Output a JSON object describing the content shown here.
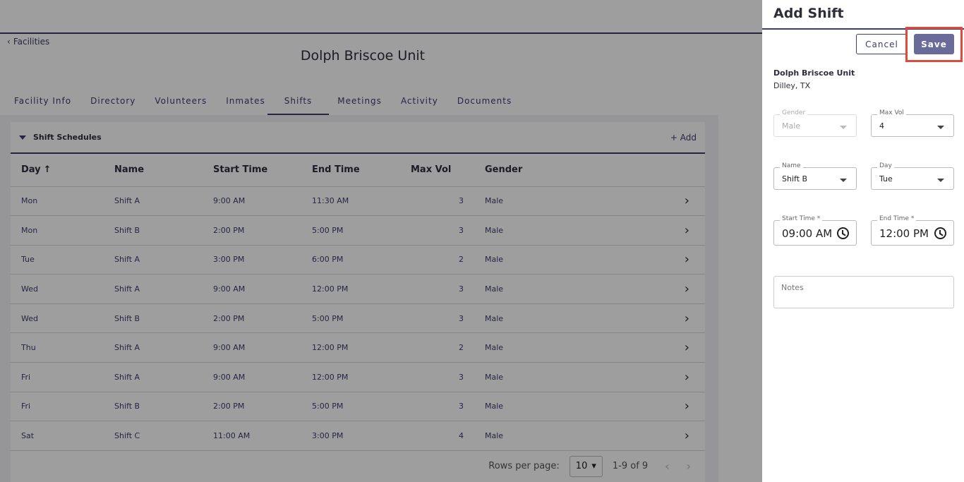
{
  "facility": {
    "back_label": "Facilities",
    "title": "Dolph Briscoe Unit"
  },
  "tabs": [
    "Facility Info",
    "Directory",
    "Volunteers",
    "Inmates",
    "Shifts",
    "Meetings",
    "Activity",
    "Documents"
  ],
  "active_tab": "Shifts",
  "panel": {
    "title": "Shift Schedules",
    "add_label": "+ Add"
  },
  "table": {
    "columns": [
      "Day",
      "Name",
      "Start Time",
      "End Time",
      "Max Vol",
      "Gender"
    ],
    "sort_indicator": "↑",
    "rows": [
      [
        "Mon",
        "Shift A",
        "9:00 AM",
        "11:30 AM",
        "3",
        "Male"
      ],
      [
        "Mon",
        "Shift B",
        "2:00 PM",
        "5:00 PM",
        "3",
        "Male"
      ],
      [
        "Tue",
        "Shift A",
        "3:00 PM",
        "6:00 PM",
        "2",
        "Male"
      ],
      [
        "Wed",
        "Shift A",
        "9:00 AM",
        "12:00 PM",
        "3",
        "Male"
      ],
      [
        "Wed",
        "Shift B",
        "2:00 PM",
        "5:00 PM",
        "3",
        "Male"
      ],
      [
        "Thu",
        "Shift A",
        "9:00 AM",
        "12:00 PM",
        "2",
        "Male"
      ],
      [
        "Fri",
        "Shift A",
        "9:00 AM",
        "12:00 PM",
        "3",
        "Male"
      ],
      [
        "Fri",
        "Shift B",
        "2:00 PM",
        "5:00 PM",
        "3",
        "Male"
      ],
      [
        "Sat",
        "Shift C",
        "11:00 AM",
        "3:00 PM",
        "4",
        "Male"
      ]
    ]
  },
  "pager": {
    "rows_label": "Rows per page:",
    "rows_value": "10",
    "range": "1-9 of 9"
  },
  "drawer": {
    "title": "Add Shift",
    "cancel_label": "Cancel",
    "save_label": "Save",
    "facility_name": "Dolph Briscoe Unit",
    "facility_location": "Dilley, TX",
    "fields": {
      "gender": {
        "label": "Gender",
        "value": "Male"
      },
      "max_vol": {
        "label": "Max Vol",
        "value": "4"
      },
      "name": {
        "label": "Name",
        "value": "Shift B"
      },
      "day": {
        "label": "Day",
        "value": "Tue"
      },
      "start_time": {
        "label": "Start Time *",
        "value": "09:00 AM"
      },
      "end_time": {
        "label": "End Time *",
        "value": "12:00 PM"
      },
      "notes": {
        "placeholder": "Notes"
      }
    }
  },
  "colors": {
    "primary": "#3d3d6b",
    "save_button": "#6b6b9a",
    "highlight": "#e04a3b"
  }
}
